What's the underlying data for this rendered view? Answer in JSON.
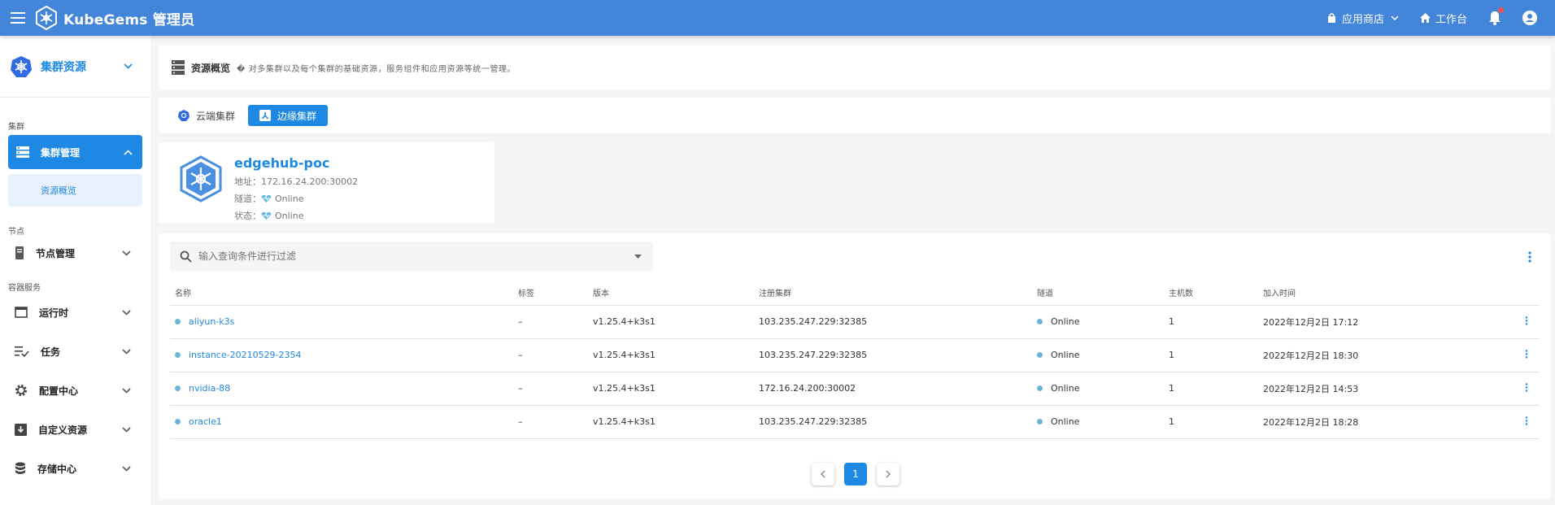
{
  "header": {
    "app_name": "KubeGems 管理员",
    "app_store": "应用商店",
    "workbench": "工作台"
  },
  "sidebar": {
    "top_label": "集群资源",
    "section_cluster": "集群",
    "cluster_mgmt": "集群管理",
    "resource_overview": "资源概览",
    "section_node": "节点",
    "node_mgmt": "节点管理",
    "section_container": "容器服务",
    "runtime": "运行时",
    "jobs": "任务",
    "config_center": "配置中心",
    "custom_resources": "自定义资源",
    "storage_center": "存储中心"
  },
  "overview": {
    "title": "资源概览",
    "description": "� 对多集群以及每个集群的基础资源，服务组件和应用资源等统一管理。"
  },
  "tabs": [
    {
      "label": "云端集群",
      "active": false
    },
    {
      "label": "边缘集群",
      "active": true
    }
  ],
  "cluster": {
    "name": "edgehub-poc",
    "address_label": "地址：",
    "address": "172.16.24.200:30002",
    "tunnel_label": "隧道：",
    "tunnel": "Online",
    "status_label": "状态：",
    "status": "Online"
  },
  "search": {
    "placeholder": "输入查询条件进行过滤"
  },
  "table": {
    "headers": {
      "name": "名称",
      "labels": "标签",
      "version": "版本",
      "register_cluster": "注册集群",
      "tunnel": "隧道",
      "hosts": "主机数",
      "joined": "加入时间"
    },
    "rows": [
      {
        "name": "aliyun-k3s",
        "labels": "–",
        "version": "v1.25.4+k3s1",
        "register": "103.235.247.229:32385",
        "tunnel": "Online",
        "hosts": "1",
        "joined": "2022年12月2日 17:12"
      },
      {
        "name": "instance-20210529-2354",
        "labels": "–",
        "version": "v1.25.4+k3s1",
        "register": "103.235.247.229:32385",
        "tunnel": "Online",
        "hosts": "1",
        "joined": "2022年12月2日 18:30"
      },
      {
        "name": "nvidia-88",
        "labels": "–",
        "version": "v1.25.4+k3s1",
        "register": "172.16.24.200:30002",
        "tunnel": "Online",
        "hosts": "1",
        "joined": "2022年12月2日 14:53"
      },
      {
        "name": "oracle1",
        "labels": "–",
        "version": "v1.25.4+k3s1",
        "register": "103.235.247.229:32385",
        "tunnel": "Online",
        "hosts": "1",
        "joined": "2022年12月2日 18:28"
      }
    ]
  },
  "pagination": {
    "current": "1"
  }
}
